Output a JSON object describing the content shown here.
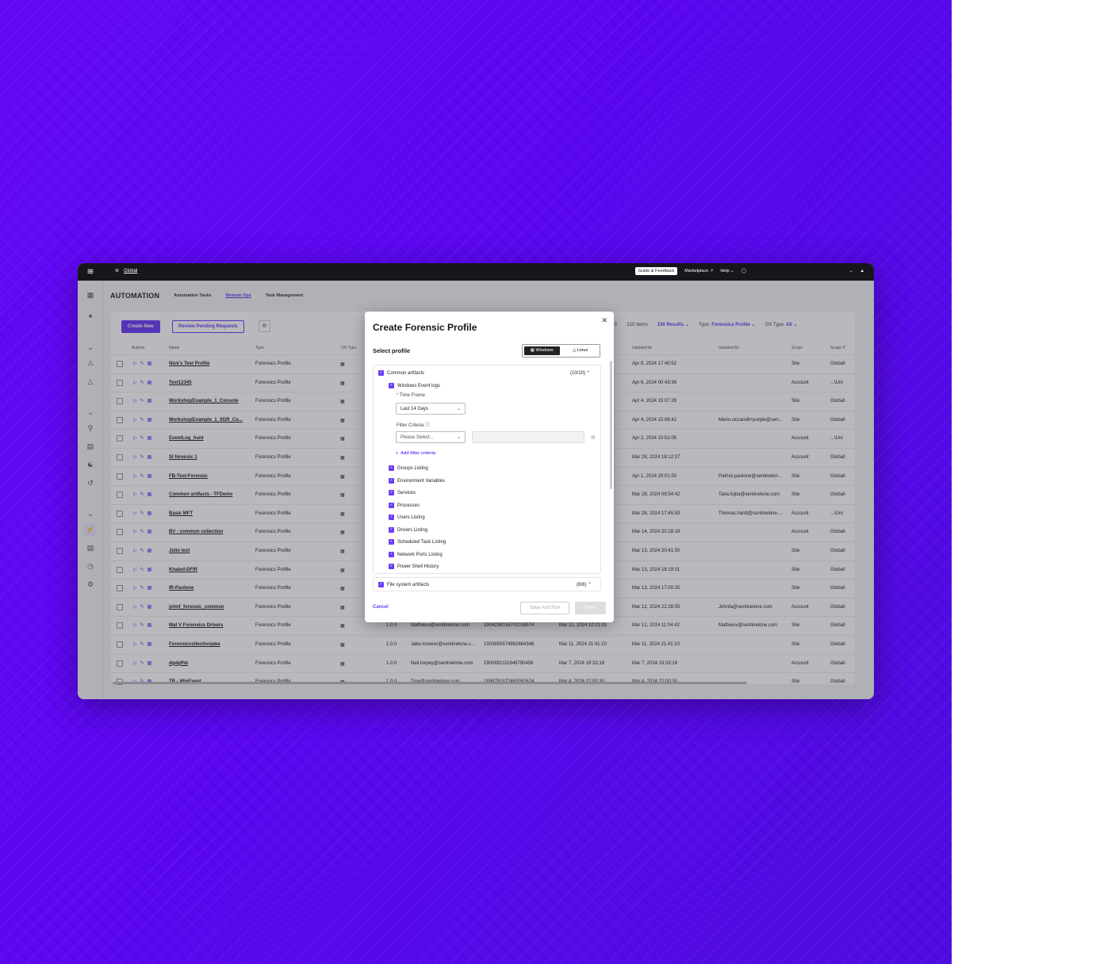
{
  "topbar": {
    "scope": "Global",
    "guide": "Guide & Feedback",
    "marketplace": "Marketplace",
    "help": "Help"
  },
  "page": {
    "title": "AUTOMATION",
    "tabs": [
      "Automation Tasks",
      "Remote Ops",
      "Task Management"
    ],
    "selected_tab": "Remote Ops"
  },
  "toolbar": {
    "create": "Create New",
    "review": "Review Pending Requests",
    "items": "210 Items",
    "results": "100 Results",
    "type_label": "Type:",
    "type_value": "Forensics Profile",
    "os_label": "OS Type:",
    "os_value": "All"
  },
  "columns": {
    "actions": "Actions",
    "name": "Name",
    "type": "Type",
    "os": "OS Type",
    "updated_at": "Updated At",
    "updated_by": "Updated By",
    "scope": "Scope",
    "scope_path": "Scope P"
  },
  "rows": [
    {
      "name": "Nick's Test Profile",
      "type": "Forensics Profile",
      "ver": "",
      "creator": "",
      "id": "",
      "created": "",
      "updated": "Apr 8, 2024 17:40:52",
      "by": "",
      "scope": "Site",
      "path": "Global\\"
    },
    {
      "name": "Test12345",
      "type": "Forensics Profile",
      "ver": "",
      "creator": "",
      "id": "",
      "created": "",
      "updated": "Apr 6, 2024 00:43:36",
      "by": "",
      "scope": "Account",
      "path": "...\\Uni"
    },
    {
      "name": "WorkshopExample_1_Console",
      "type": "Forensics Profile",
      "ver": "",
      "creator": "",
      "id": "",
      "created": "",
      "updated": "Apr 4, 2024 15:07:26",
      "by": "",
      "scope": "Site",
      "path": "Global\\"
    },
    {
      "name": "WorkshopExample_1_XDR_Co...",
      "type": "Forensics Profile",
      "ver": "",
      "creator": "",
      "id": "",
      "created": "",
      "updated": "Apr 4, 2024 15:06:42",
      "by": "Mario.ciccarelli+purple@sen...",
      "scope": "Site",
      "path": "Global\\"
    },
    {
      "name": "EventLog_hunt",
      "type": "Forensics Profile",
      "ver": "",
      "creator": "",
      "id": "",
      "created": "",
      "updated": "Apr 2, 2024 10:51:05",
      "by": "",
      "scope": "Account",
      "path": "...\\Uni"
    },
    {
      "name": "SI forensic 1",
      "type": "Forensics Profile",
      "ver": "",
      "creator": "",
      "id": "",
      "created": "",
      "updated": "Mar 28, 2024 18:12:27",
      "by": "",
      "scope": "Account",
      "path": "Global\\"
    },
    {
      "name": "FB-Test-Forensic",
      "type": "Forensics Profile",
      "ver": "",
      "creator": "",
      "id": "",
      "created": "",
      "updated": "Apr 1, 2024 20:01:50",
      "by": "Patrick.paolone@sentinelon...",
      "scope": "Site",
      "path": "Global\\"
    },
    {
      "name": "Common artifacts - TFDemo",
      "type": "Forensics Profile",
      "ver": "",
      "creator": "",
      "id": "",
      "created": "",
      "updated": "Mar 28, 2024 09:54:42",
      "by": "Taira.fujita@sentinelone.com",
      "scope": "Site",
      "path": "Global\\"
    },
    {
      "name": "Basic MFT",
      "type": "Forensics Profile",
      "ver": "",
      "creator": "",
      "id": "",
      "created": "",
      "updated": "Mar 28, 2024 17:45:53",
      "by": "Thomas.hardt@sentinelone....",
      "scope": "Account",
      "path": "...\\Uni"
    },
    {
      "name": "BV - common collection",
      "type": "Forensics Profile",
      "ver": "",
      "creator": "",
      "id": "",
      "created": "",
      "updated": "Mar 14, 2024 20:28:19",
      "by": "",
      "scope": "Account",
      "path": "Global\\"
    },
    {
      "name": "Julio test",
      "type": "Forensics Profile",
      "ver": "",
      "creator": "",
      "id": "",
      "created": "",
      "updated": "Mar 13, 2024 20:41:50",
      "by": "",
      "scope": "Site",
      "path": "Global\\"
    },
    {
      "name": "Khaled-DFIR",
      "type": "Forensics Profile",
      "ver": "",
      "creator": "",
      "id": "",
      "created": "",
      "updated": "Mar 13, 2024 18:19:01",
      "by": "",
      "scope": "Site",
      "path": "Global\\"
    },
    {
      "name": "IR-Paolone",
      "type": "Forensics Profile",
      "ver": "",
      "creator": "",
      "id": "",
      "created": "",
      "updated": "Mar 13, 2024 17:00:25",
      "by": "",
      "scope": "Site",
      "path": "Global\\"
    },
    {
      "name": "johnf_forensic_common",
      "type": "Forensics Profile",
      "ver": "",
      "creator": "",
      "id": "",
      "created": "",
      "updated": "Mar 12, 2024 22:28:55",
      "by": "Johnfa@sentinelone.com",
      "scope": "Account",
      "path": "Global\\"
    },
    {
      "name": "Mat V Forensics Drivers",
      "type": "Forensics Profile",
      "ver": "1.0.0",
      "creator": "Mathieuv@sentinelone.com",
      "id": "1904238016701016574",
      "created": "Mar 12, 2024 10:21:01",
      "updated": "Mar 12, 2024 11:04:42",
      "by": "Mathieuv@sentinelone.com",
      "scope": "Site",
      "path": "Global\\"
    },
    {
      "name": "Forensiccollectionjake",
      "type": "Forensics Profile",
      "ver": "1.0.0",
      "creator": "Jake.mowrer@sentinelone.c...",
      "id": "1903855574982864348",
      "created": "Mar 11, 2024 21:41:10",
      "updated": "Mar 11, 2024 21:41:10",
      "by": "",
      "scope": "Site",
      "path": "Global\\"
    },
    {
      "name": "dgdgfhb",
      "type": "Forensics Profile",
      "ver": "1.0.0",
      "creator": "Neil.torpey@sentinelone.com",
      "id": "1900892111649780456",
      "created": "Mar 7, 2024 19:33:18",
      "updated": "Mar 7, 2024 19:33:18",
      "by": "",
      "scope": "Account",
      "path": "Global\\"
    },
    {
      "name": "TR - WinEvent",
      "type": "Forensics Profile",
      "ver": "1.0.0",
      "creator": "Troy@sentinelone.com",
      "id": "1898791872463362674",
      "created": "Mar 4, 2024 22:00:30",
      "updated": "Mar 4, 2024 22:00:30",
      "by": "",
      "scope": "Site",
      "path": "Global\\"
    }
  ],
  "modal": {
    "title": "Create Forensic Profile",
    "select_profile": "Select profile",
    "os_windows": "Windows",
    "os_linux": "Linux",
    "common": "Common artifacts",
    "common_count": "(10/10)",
    "event_logs": "Windows Event logs",
    "time_frame": "Time Frame",
    "time_value": "Last 14 Days",
    "filter_criteria": "Filter Criteria",
    "filter_placeholder": "Please Select...",
    "add_filter": "Add filter criteria",
    "items": [
      "Groups Listing",
      "Environment Variables",
      "Services",
      "Processes",
      "Users Listing",
      "Drivers Listing",
      "Scheduled Task Listing",
      "Network Ports Listing",
      "Power Shell History"
    ],
    "fs": "File system artifacts",
    "fs_count": "(8/8)",
    "cancel": "Cancel",
    "save_run": "Save And Run",
    "save": "Save"
  }
}
